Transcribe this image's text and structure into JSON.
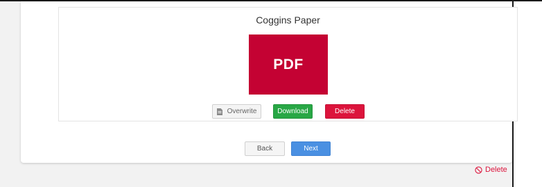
{
  "document": {
    "title": "Coggins Paper",
    "thumbnail_label": "PDF"
  },
  "actions": {
    "overwrite_label": "Overwrite",
    "download_label": "Download",
    "delete_label": "Delete"
  },
  "navigation": {
    "back_label": "Back",
    "next_label": "Next"
  },
  "footer": {
    "delete_label": "Delete"
  },
  "colors": {
    "pdf_bg": "#c40233",
    "download": "#28a745",
    "delete": "#dc143c",
    "next": "#4a90e2"
  },
  "icons": {
    "overwrite": "file-icon",
    "footer_delete": "ban-icon"
  }
}
